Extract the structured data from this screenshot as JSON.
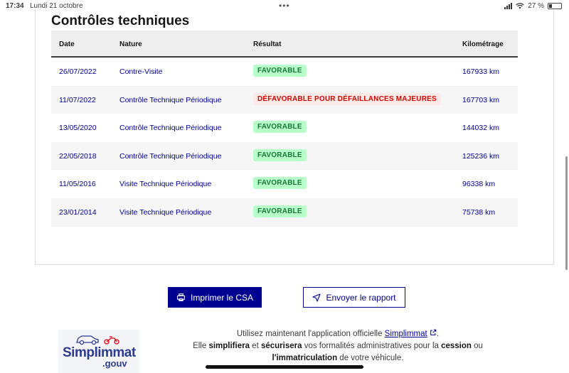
{
  "status_bar": {
    "time": "17:34",
    "date": "Lundi 21 octobre",
    "battery_percent": 27,
    "battery_label": "27 %"
  },
  "section": {
    "title": "Contrôles techniques"
  },
  "table": {
    "headers": {
      "date": "Date",
      "nature": "Nature",
      "result": "Résultat",
      "mileage": "Kilométrage"
    },
    "rows": [
      {
        "date": "26/07/2022",
        "nature": "Contre-Visite",
        "result": "FAVORABLE",
        "status": "ok",
        "mileage": "167933 km"
      },
      {
        "date": "11/07/2022",
        "nature": "Contrôle Technique Périodique",
        "result": "DÉFAVORABLE POUR DÉFAILLANCES MAJEURES",
        "status": "ko",
        "mileage": "167703 km"
      },
      {
        "date": "13/05/2020",
        "nature": "Contrôle Technique Périodique",
        "result": "FAVORABLE",
        "status": "ok",
        "mileage": "144032 km"
      },
      {
        "date": "22/05/2018",
        "nature": "Contrôle Technique Périodique",
        "result": "FAVORABLE",
        "status": "ok",
        "mileage": "125236 km"
      },
      {
        "date": "11/05/2016",
        "nature": "Visite Technique Périodique",
        "result": "FAVORABLE",
        "status": "ok",
        "mileage": "96338 km"
      },
      {
        "date": "23/01/2014",
        "nature": "Visite Technique Périodique",
        "result": "FAVORABLE",
        "status": "ok",
        "mileage": "75738 km"
      }
    ]
  },
  "actions": {
    "print_label": "Imprimer le CSA",
    "send_label": "Envoyer le rapport"
  },
  "promo": {
    "logo_text": "Simplimmat",
    "logo_suffix": ".gouv",
    "line1_prefix": "Utilisez maintenant l'application officielle ",
    "line1_link": "Simplimmat",
    "line1_suffix": ".",
    "line2_a": "Elle ",
    "line2_b": "simplifiera",
    "line2_c": " et ",
    "line2_d": "sécurisera",
    "line2_e": " vos formalités administratives pour la ",
    "line2_f": "cession",
    "line2_g": " ou",
    "line3_a": "l'immatriculation",
    "line3_b": " de votre véhicule."
  },
  "colors": {
    "primary": "#000091",
    "favorable_bg": "#b8fec9",
    "favorable_text": "#18753c",
    "defavorable_bg": "#ffe9e6",
    "defavorable_text": "#ce0500"
  }
}
